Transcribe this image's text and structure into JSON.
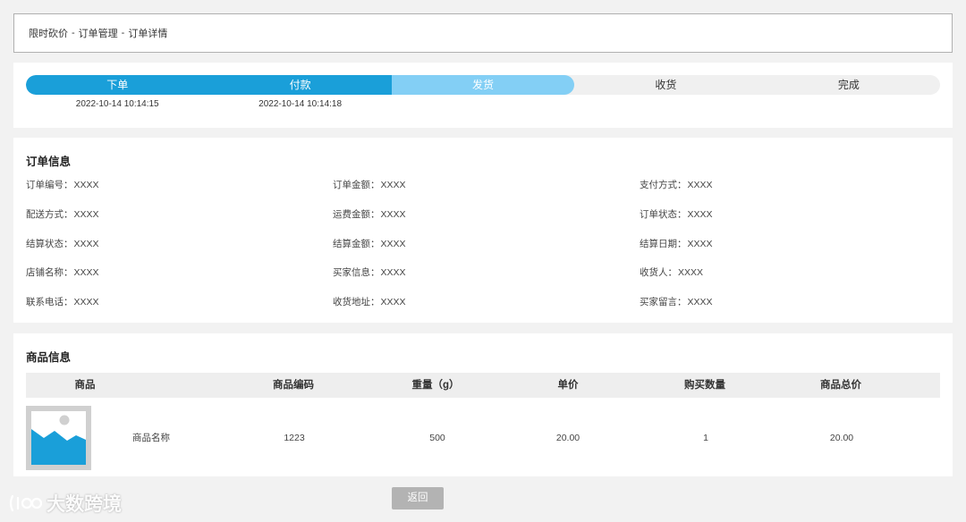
{
  "breadcrumb": [
    "限时砍价",
    "订单管理",
    "订单详情"
  ],
  "breadcrumb_separator": "-",
  "progress": {
    "completed_steps": 2,
    "current_step": 3,
    "steps": [
      {
        "label": "下单",
        "time": "2022-10-14 10:14:15",
        "state": "done"
      },
      {
        "label": "付款",
        "time": "2022-10-14 10:14:18",
        "state": "done"
      },
      {
        "label": "发货",
        "time": "",
        "state": "current"
      },
      {
        "label": "收货",
        "time": "",
        "state": "todo"
      },
      {
        "label": "完成",
        "time": "",
        "state": "todo"
      }
    ],
    "colors": {
      "done": "#1a9fd9",
      "current": "#83cff5",
      "todo": "#f0f0f0"
    }
  },
  "order_info": {
    "title": "订单信息",
    "rows": [
      [
        {
          "label": "订单编号：",
          "value": "XXXX"
        },
        {
          "label": "订单金额：",
          "value": "XXXX"
        },
        {
          "label": "支付方式：",
          "value": "XXXX"
        }
      ],
      [
        {
          "label": "配送方式：",
          "value": "XXXX"
        },
        {
          "label": "运费金额：",
          "value": "XXXX"
        },
        {
          "label": "订单状态：",
          "value": "XXXX"
        }
      ],
      [
        {
          "label": "结算状态：",
          "value": "XXXX"
        },
        {
          "label": "结算金额：",
          "value": "XXXX"
        },
        {
          "label": "结算日期：",
          "value": "XXXX"
        }
      ],
      [
        {
          "label": "店铺名称：",
          "value": "XXXX"
        },
        {
          "label": "买家信息：",
          "value": "XXXX"
        },
        {
          "label": "收货人：",
          "value": "XXXX"
        }
      ],
      [
        {
          "label": "联系电话：",
          "value": "XXXX"
        },
        {
          "label": "收货地址：",
          "value": "XXXX"
        },
        {
          "label": "买家留言：",
          "value": "XXXX"
        }
      ]
    ]
  },
  "product_info": {
    "title": "商品信息",
    "columns": [
      "商品",
      "商品编码",
      "重量（g）",
      "单价",
      "购买数量",
      "商品总价"
    ],
    "rows": [
      {
        "image_icon": "image-placeholder-icon",
        "name": "商品名称",
        "code": "1223",
        "weight": "500",
        "price": "20.00",
        "quantity": "1",
        "total": "20.00"
      }
    ]
  },
  "back_label": "返回",
  "watermark": {
    "text": "大数跨境",
    "icon": "logo-icon"
  }
}
